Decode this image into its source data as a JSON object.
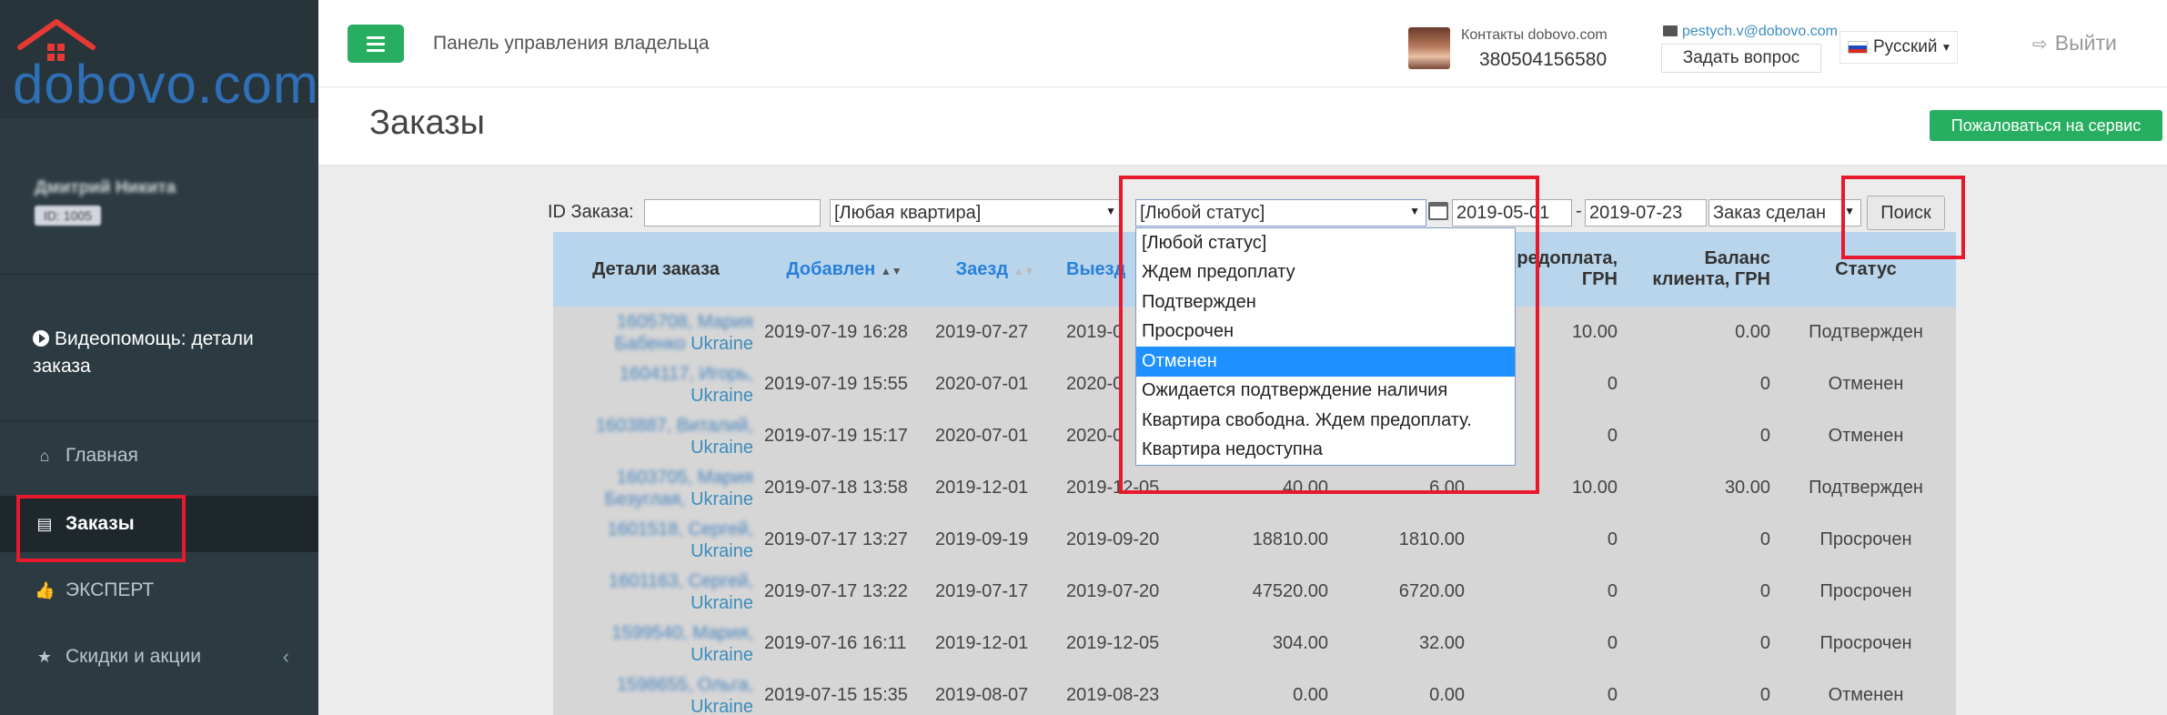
{
  "sidebar": {
    "logo": "dobovo.com",
    "user_name": "Дмитрий Никита",
    "user_id": "ID: 1005",
    "video_help": "Видеопомощь: детали заказа",
    "nav": [
      {
        "label": "Главная",
        "icon": "home-icon"
      },
      {
        "label": "Заказы",
        "icon": "book-icon"
      },
      {
        "label": "ЭКСПЕРТ",
        "icon": "thumbs-up-icon"
      },
      {
        "label": "Скидки и акции",
        "icon": "star-icon"
      }
    ]
  },
  "header": {
    "panel_title": "Панель управления владельца",
    "contacts_label": "Контакты dobovo.com",
    "contacts_phone": "380504156580",
    "email": "pestych.v@dobovo.com",
    "ask_question": "Задать вопрос",
    "language": "Русский",
    "logout": "Выйти"
  },
  "page": {
    "title": "Заказы",
    "complain_button": "Пожаловаться на сервис"
  },
  "filters": {
    "order_id_label": "ID Заказа:",
    "order_id_value": "",
    "apartment": "[Любая квартира]",
    "status": "[Любой статус]",
    "date_from": "2019-05-01",
    "date_to": "2019-07-23",
    "date_type": "Заказ сделан",
    "search_button": "Поиск"
  },
  "status_dropdown": {
    "options": [
      "[Любой статус]",
      "Ждем предоплату",
      "Подтвержден",
      "Просрочен",
      "Отменен",
      "Ожидается подтверждение наличия",
      "Квартира свободна. Ждем предоплату.",
      "Квартира недоступна"
    ],
    "highlighted_index": 4
  },
  "table": {
    "headers": {
      "details": "Детали заказа",
      "added": "Добавлен",
      "checkin": "Заезд",
      "checkout": "Выезд",
      "prepay": "Предоплата, ГРН",
      "balance": "Баланс клиента, ГРН",
      "status": "Статус"
    },
    "rows": [
      {
        "id": "1605708, Мария",
        "name": "Бабенко",
        "country": "Ukraine",
        "added": "2019-07-19 16:28",
        "checkin": "2019-07-27",
        "checkout": "2019-0",
        "total": "",
        "commission": "",
        "prepay": "10.00",
        "balance": "0.00",
        "status": "Подтвержден"
      },
      {
        "id": "1604117, Игорь,",
        "name": "",
        "country": "Ukraine",
        "added": "2019-07-19 15:55",
        "checkin": "2020-07-01",
        "checkout": "2020-0",
        "total": "",
        "commission": "",
        "prepay": "0",
        "balance": "0",
        "status": "Отменен"
      },
      {
        "id": "1603887, Виталий,",
        "name": "",
        "country": "Ukraine",
        "added": "2019-07-19 15:17",
        "checkin": "2020-07-01",
        "checkout": "2020-0",
        "total": "",
        "commission": "",
        "prepay": "0",
        "balance": "0",
        "status": "Отменен"
      },
      {
        "id": "1603705, Мария",
        "name": "Безуглая,",
        "country": "Ukraine",
        "added": "2019-07-18 13:58",
        "checkin": "2019-12-01",
        "checkout": "2019-12-05",
        "total": "40.00",
        "commission": "6.00",
        "prepay": "10.00",
        "balance": "30.00",
        "status": "Подтвержден"
      },
      {
        "id": "1601518, Сергей,",
        "name": "",
        "country": "Ukraine",
        "added": "2019-07-17 13:27",
        "checkin": "2019-09-19",
        "checkout": "2019-09-20",
        "total": "18810.00",
        "commission": "1810.00",
        "prepay": "0",
        "balance": "0",
        "status": "Просрочен"
      },
      {
        "id": "1601163, Сергей,",
        "name": "",
        "country": "Ukraine",
        "added": "2019-07-17 13:22",
        "checkin": "2019-07-17",
        "checkout": "2019-07-20",
        "total": "47520.00",
        "commission": "6720.00",
        "prepay": "0",
        "balance": "0",
        "status": "Просрочен"
      },
      {
        "id": "1599540, Мария,",
        "name": "",
        "country": "Ukraine",
        "added": "2019-07-16 16:11",
        "checkin": "2019-12-01",
        "checkout": "2019-12-05",
        "total": "304.00",
        "commission": "32.00",
        "prepay": "0",
        "balance": "0",
        "status": "Просрочен"
      },
      {
        "id": "1598655, Ольга,",
        "name": "",
        "country": "Ukraine",
        "added": "2019-07-15 15:35",
        "checkin": "2019-08-07",
        "checkout": "2019-08-23",
        "total": "0.00",
        "commission": "0.00",
        "prepay": "0",
        "balance": "0",
        "status": "Отменен"
      }
    ]
  },
  "colors": {
    "sidebar_bg": "#2c3b41",
    "accent_green": "#27ae60",
    "table_header": "#b9d5ec",
    "highlight_red": "#e8192c",
    "selected_option": "#1e90ff"
  }
}
